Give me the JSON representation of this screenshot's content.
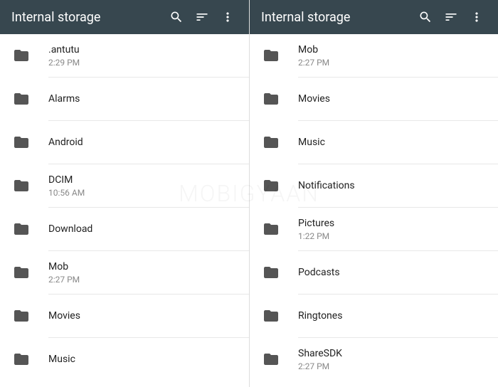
{
  "watermark": "MOBIGYAAN",
  "left": {
    "title": "Internal storage",
    "items": [
      {
        "name": ".antutu",
        "time": "2:29 PM"
      },
      {
        "name": "Alarms",
        "time": ""
      },
      {
        "name": "Android",
        "time": ""
      },
      {
        "name": "DCIM",
        "time": "10:56 AM"
      },
      {
        "name": "Download",
        "time": ""
      },
      {
        "name": "Mob",
        "time": "2:27 PM"
      },
      {
        "name": "Movies",
        "time": ""
      },
      {
        "name": "Music",
        "time": ""
      }
    ]
  },
  "right": {
    "title": "Internal storage",
    "items": [
      {
        "name": "Mob",
        "time": "2:27 PM"
      },
      {
        "name": "Movies",
        "time": ""
      },
      {
        "name": "Music",
        "time": ""
      },
      {
        "name": "Notifications",
        "time": ""
      },
      {
        "name": "Pictures",
        "time": "1:22 PM"
      },
      {
        "name": "Podcasts",
        "time": ""
      },
      {
        "name": "Ringtones",
        "time": ""
      },
      {
        "name": "ShareSDK",
        "time": "2:27 PM"
      }
    ]
  }
}
